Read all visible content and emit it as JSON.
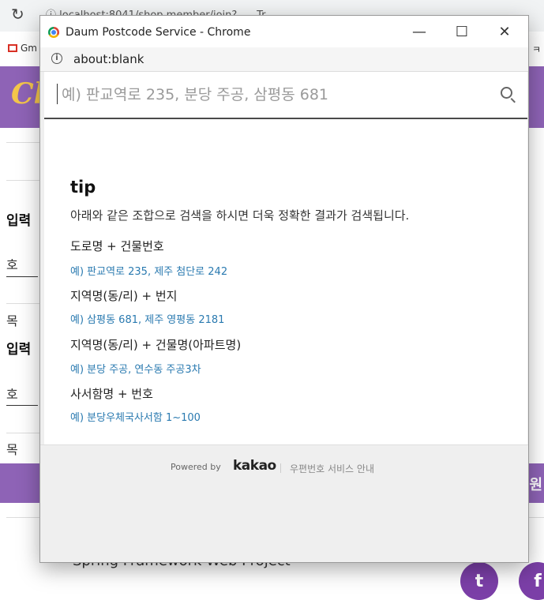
{
  "background": {
    "url_text": "ⓘ localhost:8041/shop member/join?..... Tr.... ...",
    "bookmark_gmail": "Gm",
    "bookmark_right": "게 ㅋ",
    "logo_text": "Cl",
    "section1_title": "입력",
    "field1_label": "호",
    "field2_label": "목",
    "section2_title": "입력",
    "field3_label": "호",
    "field4_label": "목",
    "button_label": "원",
    "footer_text": "Spring Framework Web Project",
    "social_twitter": "t",
    "social_facebook": "f"
  },
  "popup": {
    "window_title": "Daum Postcode Service - Chrome",
    "address": "about:blank",
    "search": {
      "placeholder": "예) 판교역로 235, 분당 주공, 삼평동 681"
    },
    "tip": {
      "title": "tip",
      "description": "아래와 같은 조합으로 검색을 하시면 더욱 정확한 결과가 검색됩니다.",
      "items": [
        {
          "head": "도로명 + 건물번호",
          "example": "예) 판교역로 235,  제주 첨단로 242"
        },
        {
          "head": "지역명(동/리) + 번지",
          "example": "예) 삼평동 681,  제주 영평동 2181"
        },
        {
          "head": "지역명(동/리) + 건물명(아파트명)",
          "example": "예) 분당 주공,  연수동 주공3차"
        },
        {
          "head": "사서함명 + 번호",
          "example": "예) 분당우체국사서함 1~100"
        }
      ]
    },
    "footer": {
      "powered_by": "Powered by",
      "brand": "kakao",
      "guide_link": "우편번호 서비스 안내"
    }
  }
}
